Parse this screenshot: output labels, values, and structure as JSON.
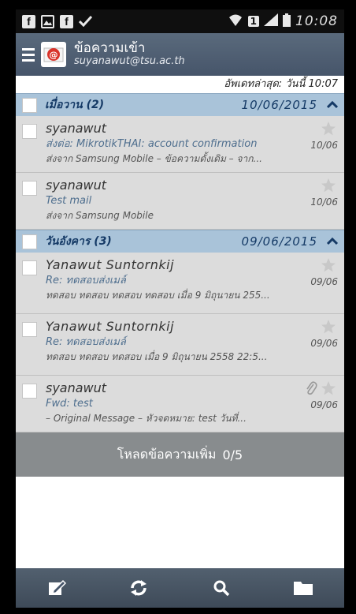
{
  "status_bar": {
    "left_icons": [
      "facebook-icon",
      "image-icon",
      "facebook-icon",
      "check-icon"
    ],
    "sim_badge": "1",
    "time": "10:08"
  },
  "app_bar": {
    "title": "ข้อความเข้า",
    "account": "suyanawut@tsu.ac.th"
  },
  "last_update": "อัพเดทล่าสุด: วันนี้ 10:07",
  "groups": [
    {
      "title": "เมื่อวาน (2)",
      "date": "10/06/2015",
      "messages": [
        {
          "sender": "syanawut",
          "subject": "ส่งต่อ: MikrotikTHAI: account confirmation",
          "date": "10/06",
          "preview": "ส่งจาก Samsung Mobile – ข้อความดั้งเดิม – จาก..."
        },
        {
          "sender": "syanawut",
          "subject": "Test mail",
          "date": "10/06",
          "preview": "ส่งจาก Samsung Mobile"
        }
      ]
    },
    {
      "title": "วันอังคาร (3)",
      "date": "09/06/2015",
      "messages": [
        {
          "sender": "Yanawut Suntornkij",
          "subject": "Re: ทดสอบส่งเมล์",
          "date": "09/06",
          "preview": "ทดสอบ ทดสอบ ทดสอบ ทดสอบ เมื่อ 9 มิถุนายน 255..."
        },
        {
          "sender": "Yanawut Suntornkij",
          "subject": "Re: ทดสอบส่งเมล์",
          "date": "09/06",
          "preview": "ทดสอบ ทดสอบ ทดสอบ เมื่อ 9 มิถุนายน 2558 22:5..."
        },
        {
          "sender": "syanawut",
          "subject": "Fwd: test",
          "date": "09/06",
          "preview": "– Original Message – หัวจดหมาย: test วันที่..."
        }
      ]
    }
  ],
  "load_more": {
    "label": "โหลดข้อความเพิ่ม",
    "count": "0/5"
  },
  "bottom_bar": [
    "compose-icon",
    "refresh-icon",
    "search-icon",
    "folder-icon"
  ],
  "colors": {
    "app_bar": "#4e5d70",
    "group_header": "#a9c3d9",
    "mail_row": "#dcdcdc",
    "load_more": "#888c8e"
  }
}
